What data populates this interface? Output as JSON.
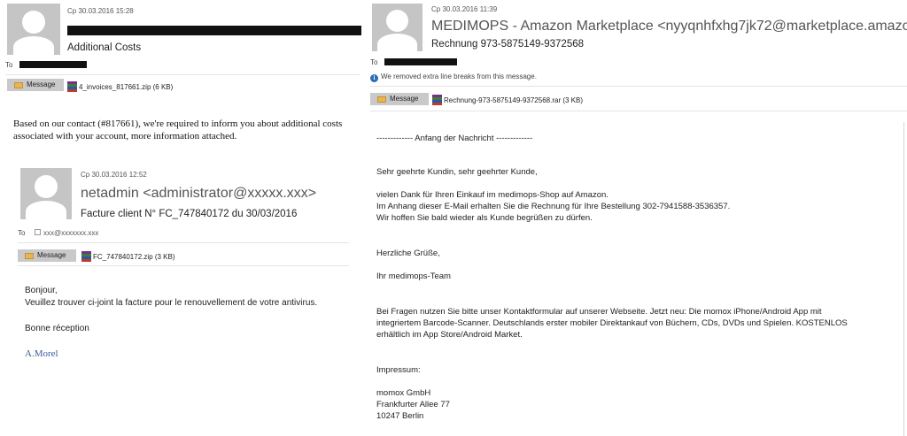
{
  "email1": {
    "date": "Ср 30.03.2016 15:28",
    "subject": "Additional Costs",
    "to_label": "To",
    "message_tab": "Message",
    "attachment": "4_invoices_817661.zip (6 KB)",
    "body": "Based on our contact (#817661), we're required to inform you about additional costs associated with your account, more information attached."
  },
  "email2": {
    "date": "Ср 30.03.2016 12:52",
    "from": "netadmin <administrator@xxxxx.xxx>",
    "subject": "Facture client N° FC_747840172 du 30/03/2016",
    "to_label": "To",
    "to_value": "xxx@xxxxxxx.xxx",
    "message_tab": "Message",
    "attachment": "FC_747840172.zip (3 KB)",
    "body_lines": [
      "Bonjour,",
      "Veuillez trouver ci-joint la facture pour le renouvellement de votre antivirus.",
      "Bonne réception"
    ],
    "signature": "A.Morel"
  },
  "email3": {
    "date": "Ср 30.03.2016 11:39",
    "from": "MEDIMOPS - Amazon Marketplace <nyyqnhfxhg7jk72@marketplace.amazon.de",
    "subject": "Rechnung 973-5875149-9372568",
    "to_label": "To",
    "info_bar": "We removed extra line breaks from this message.",
    "message_tab": "Message",
    "attachment": "Rechnung-973-5875149-9372568.rar (3 KB)",
    "body": {
      "header": "------------- Anfang der Nachricht -------------",
      "greeting": "Sehr geehrte Kundin, sehr geehrter Kunde,",
      "para1": [
        "vielen Dank für Ihren Einkauf im medimops-Shop auf Amazon.",
        "Im Anhang dieser E-Mail erhalten Sie die Rechnung für Ihre Bestellung 302-7941588-3536357.",
        "Wir hoffen Sie bald wieder als Kunde begrüßen zu dürfen."
      ],
      "regards": "Herzliche Grüße,",
      "team": "Ihr medimops-Team",
      "para2": [
        "Bei Fragen nutzen Sie bitte unser Kontaktformular auf unserer Webseite. Jetzt neu: Die momox iPhone/Android App mit",
        "integriertem Barcode-Scanner. Deutschlands erster mobiler Direktankauf von Büchern, CDs, DVDs und Spielen. KOSTENLOS",
        "erhältlich im App Store/Android Market."
      ],
      "impressum": "Impressum:",
      "company": [
        "momox GmbH",
        "Frankfurter Allee 77",
        "10247 Berlin"
      ]
    }
  }
}
